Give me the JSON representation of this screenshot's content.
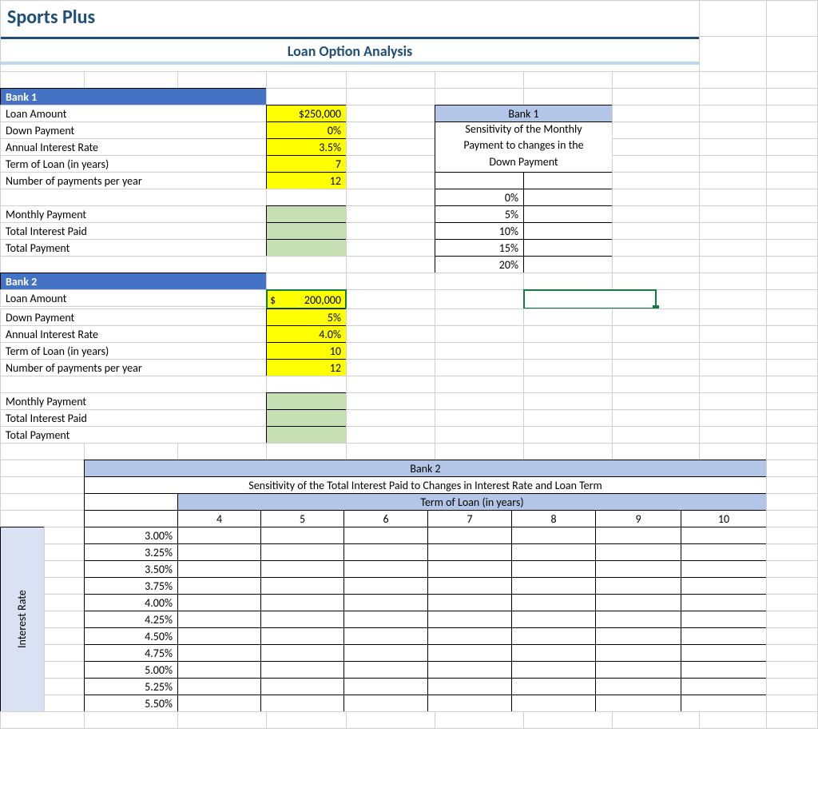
{
  "title": "Sports Plus",
  "subtitle": "Loan Option Analysis",
  "bank1_header": "Bank 1",
  "bank2_header": "Bank 2",
  "labels": {
    "loan_amount": "Loan Amount",
    "down_payment": "Down Payment",
    "annual_rate": "Annual Interest Rate",
    "term": "Term of Loan (in years)",
    "num_payments": "Number of payments per year",
    "monthly_payment": "Monthly Payment",
    "total_interest": "Total Interest Paid",
    "total_payment": "Total Payment"
  },
  "bank1": {
    "loan_amount": "$250,000",
    "down_payment": "0%",
    "annual_rate": "3.5%",
    "term": "7",
    "num_payments": "12"
  },
  "bank2": {
    "loan_amount_prefix": "$",
    "loan_amount": "200,000",
    "down_payment": "5%",
    "annual_rate": "4.0%",
    "term": "10",
    "num_payments": "12"
  },
  "sens1": {
    "header": "Bank 1",
    "desc_line1": "Sensitivity of the Monthly",
    "desc_line2": "Payment to changes in the",
    "desc_line3": "Down Payment",
    "rows": [
      "0%",
      "5%",
      "10%",
      "15%",
      "20%"
    ]
  },
  "sens2": {
    "header": "Bank 2",
    "desc": "Sensitivity of the Total Interest Paid to Changes in Interest Rate and Loan Term",
    "term_label": "Term of Loan (in years)",
    "rate_label": "Interest Rate",
    "cols": [
      "4",
      "5",
      "6",
      "7",
      "8",
      "9",
      "10"
    ],
    "rows": [
      "3.00%",
      "3.25%",
      "3.50%",
      "3.75%",
      "4.00%",
      "4.25%",
      "4.50%",
      "4.75%",
      "5.00%",
      "5.25%",
      "5.50%"
    ]
  }
}
